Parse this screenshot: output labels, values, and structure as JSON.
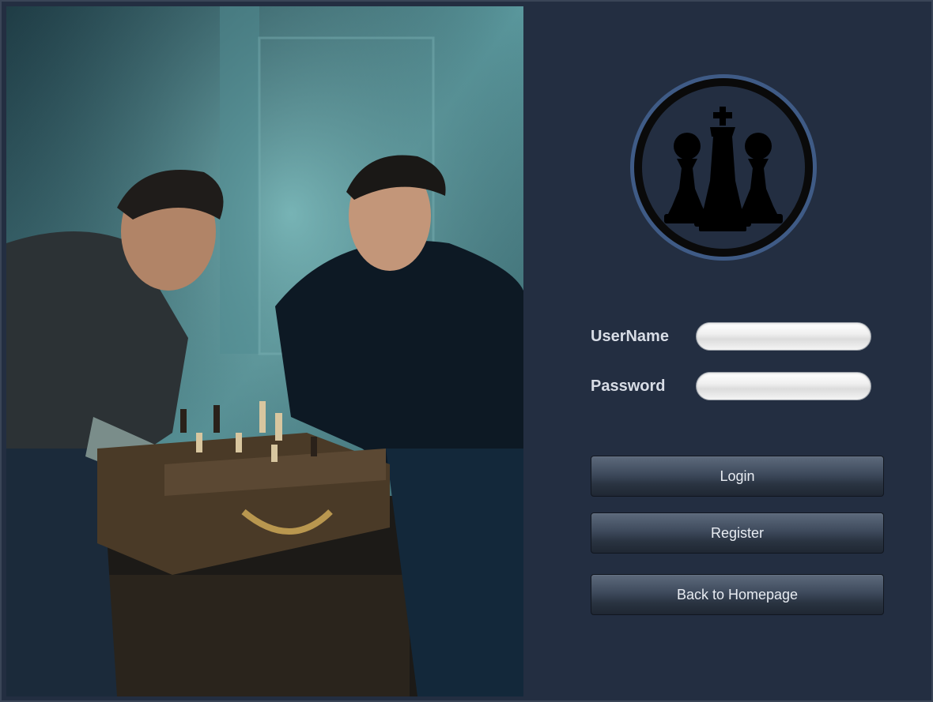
{
  "login_form": {
    "username_label": "UserName",
    "username_value": "",
    "password_label": "Password",
    "password_value": ""
  },
  "buttons": {
    "login": "Login",
    "register": "Register",
    "back_home": "Back to Homepage"
  },
  "icons": {
    "logo": "chess-pieces-icon"
  },
  "colors": {
    "background": "#232e41",
    "logo_ring": "#3f5b86",
    "label_text": "#d8dde6"
  }
}
